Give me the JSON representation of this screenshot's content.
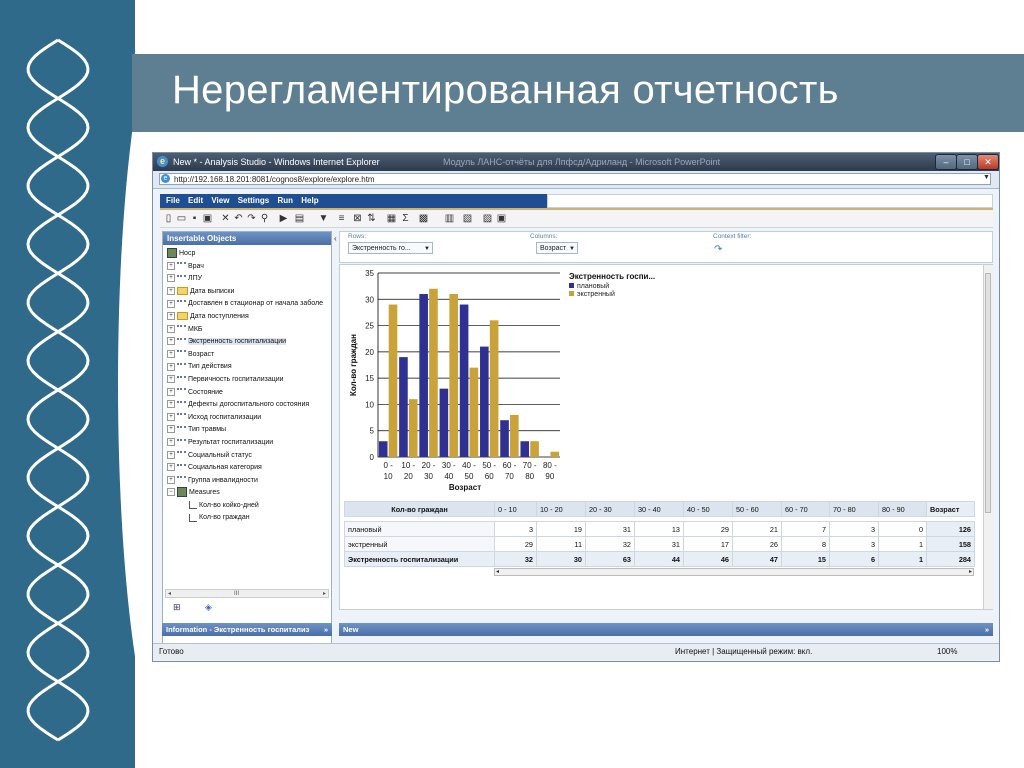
{
  "slide": {
    "title": "Нерегламентированная отчетность"
  },
  "window": {
    "title": "New * - Analysis Studio - Windows Internet Explorer",
    "background_title": "Модуль ЛАНС-отчёты для Лпфсд/Адриланд - Microsoft PowerPoint",
    "min_icon": "minimize-icon",
    "max_icon": "maximize-icon",
    "close_icon": "close-icon",
    "min_glyph": "–",
    "max_glyph": "□",
    "close_glyph": "✕"
  },
  "address": {
    "url": "http://192.168.18.201:8081/cognos8/explore/explore.htm"
  },
  "menu": [
    "File",
    "Edit",
    "View",
    "Settings",
    "Run",
    "Help"
  ],
  "insertable": {
    "header": "Insertable Objects",
    "root": "Носр",
    "items": [
      {
        "label": "Врач",
        "icon": "dimension-icon"
      },
      {
        "label": "ЛПУ",
        "icon": "dimension-icon"
      },
      {
        "label": "Дата выписки",
        "icon": "folder-icon"
      },
      {
        "label": "Доставлен в стационар от начала заболе",
        "icon": "dimension-icon"
      },
      {
        "label": "Дата поступления",
        "icon": "folder-icon"
      },
      {
        "label": "МКБ",
        "icon": "dimension-icon"
      },
      {
        "label": "Экстренность госпитализации",
        "icon": "dimension-icon",
        "selected": true
      },
      {
        "label": "Возраст",
        "icon": "dimension-icon"
      },
      {
        "label": "Тип действия",
        "icon": "dimension-icon"
      },
      {
        "label": "Первичность госпитализации",
        "icon": "dimension-icon"
      },
      {
        "label": "Состояние",
        "icon": "dimension-icon"
      },
      {
        "label": "Дефекты догоспитального состояния",
        "icon": "dimension-icon"
      },
      {
        "label": "Исход госпитализации",
        "icon": "dimension-icon"
      },
      {
        "label": "Тип травмы",
        "icon": "dimension-icon"
      },
      {
        "label": "Результат госпитализации",
        "icon": "dimension-icon"
      },
      {
        "label": "Социальный статус",
        "icon": "dimension-icon"
      },
      {
        "label": "Социальная категория",
        "icon": "dimension-icon"
      },
      {
        "label": "Группа инвалидности",
        "icon": "dimension-icon"
      },
      {
        "label": "Measures",
        "icon": "cube-icon",
        "expanded": true
      }
    ],
    "measures": [
      "Кол-во койко-дней",
      "Кол-во граждан"
    ],
    "scroll_label": "III"
  },
  "drop_zone": {
    "rows_label": "Rows:",
    "rows_value": "Экстренность го...",
    "columns_label": "Columns:",
    "columns_value": "Возраст",
    "context_label": "Context filter:"
  },
  "chart_data": {
    "type": "bar",
    "title": "Экстренность госпи...",
    "ylabel": "Кол-во граждан",
    "xlabel": "Возраст",
    "ylim": [
      0,
      35
    ],
    "yticks": [
      0,
      5,
      10,
      15,
      20,
      25,
      30,
      35
    ],
    "categories": [
      "0 - 10",
      "10 - 20",
      "20 - 30",
      "30 - 40",
      "40 - 50",
      "50 - 60",
      "60 - 70",
      "70 - 80",
      "80 - 90"
    ],
    "categories_top": [
      "0 -",
      "10 -",
      "20 -",
      "30 -",
      "40 -",
      "50 -",
      "60 -",
      "70 -",
      "80 -"
    ],
    "categories_bottom": [
      "10",
      "20",
      "30",
      "40",
      "50",
      "60",
      "70",
      "80",
      "90"
    ],
    "series": [
      {
        "name": "плановый",
        "color": "#2e3192",
        "values": [
          3,
          19,
          31,
          13,
          29,
          21,
          7,
          3,
          0
        ]
      },
      {
        "name": "экстренный",
        "color": "#c9a23a",
        "values": [
          29,
          11,
          32,
          31,
          17,
          26,
          8,
          3,
          1
        ]
      }
    ],
    "grid": true,
    "legend": "top-right"
  },
  "crosstab": {
    "corner": "Кол-во граждан",
    "columns": [
      "0 - 10",
      "10 - 20",
      "20 - 30",
      "30 - 40",
      "40 - 50",
      "50 - 60",
      "60 - 70",
      "70 - 80",
      "80 - 90"
    ],
    "total_col": "Возраст",
    "rows": [
      {
        "label": "плановый",
        "values": [
          "3",
          "19",
          "31",
          "13",
          "29",
          "21",
          "7",
          "3",
          "0"
        ],
        "total": "126"
      },
      {
        "label": "экстренный",
        "values": [
          "29",
          "11",
          "32",
          "31",
          "17",
          "26",
          "8",
          "3",
          "1"
        ],
        "total": "158"
      }
    ],
    "total_row": {
      "label": "Экстренность госпитализации",
      "values": [
        "32",
        "30",
        "63",
        "44",
        "46",
        "47",
        "15",
        "6",
        "1"
      ],
      "total": "284"
    }
  },
  "info": {
    "left": "Information - Экстренность госпитализ",
    "right": "New"
  },
  "status": {
    "text": "Готово",
    "zone": "Интернет | Защищенный режим: вкл.",
    "zoom": "100%"
  }
}
